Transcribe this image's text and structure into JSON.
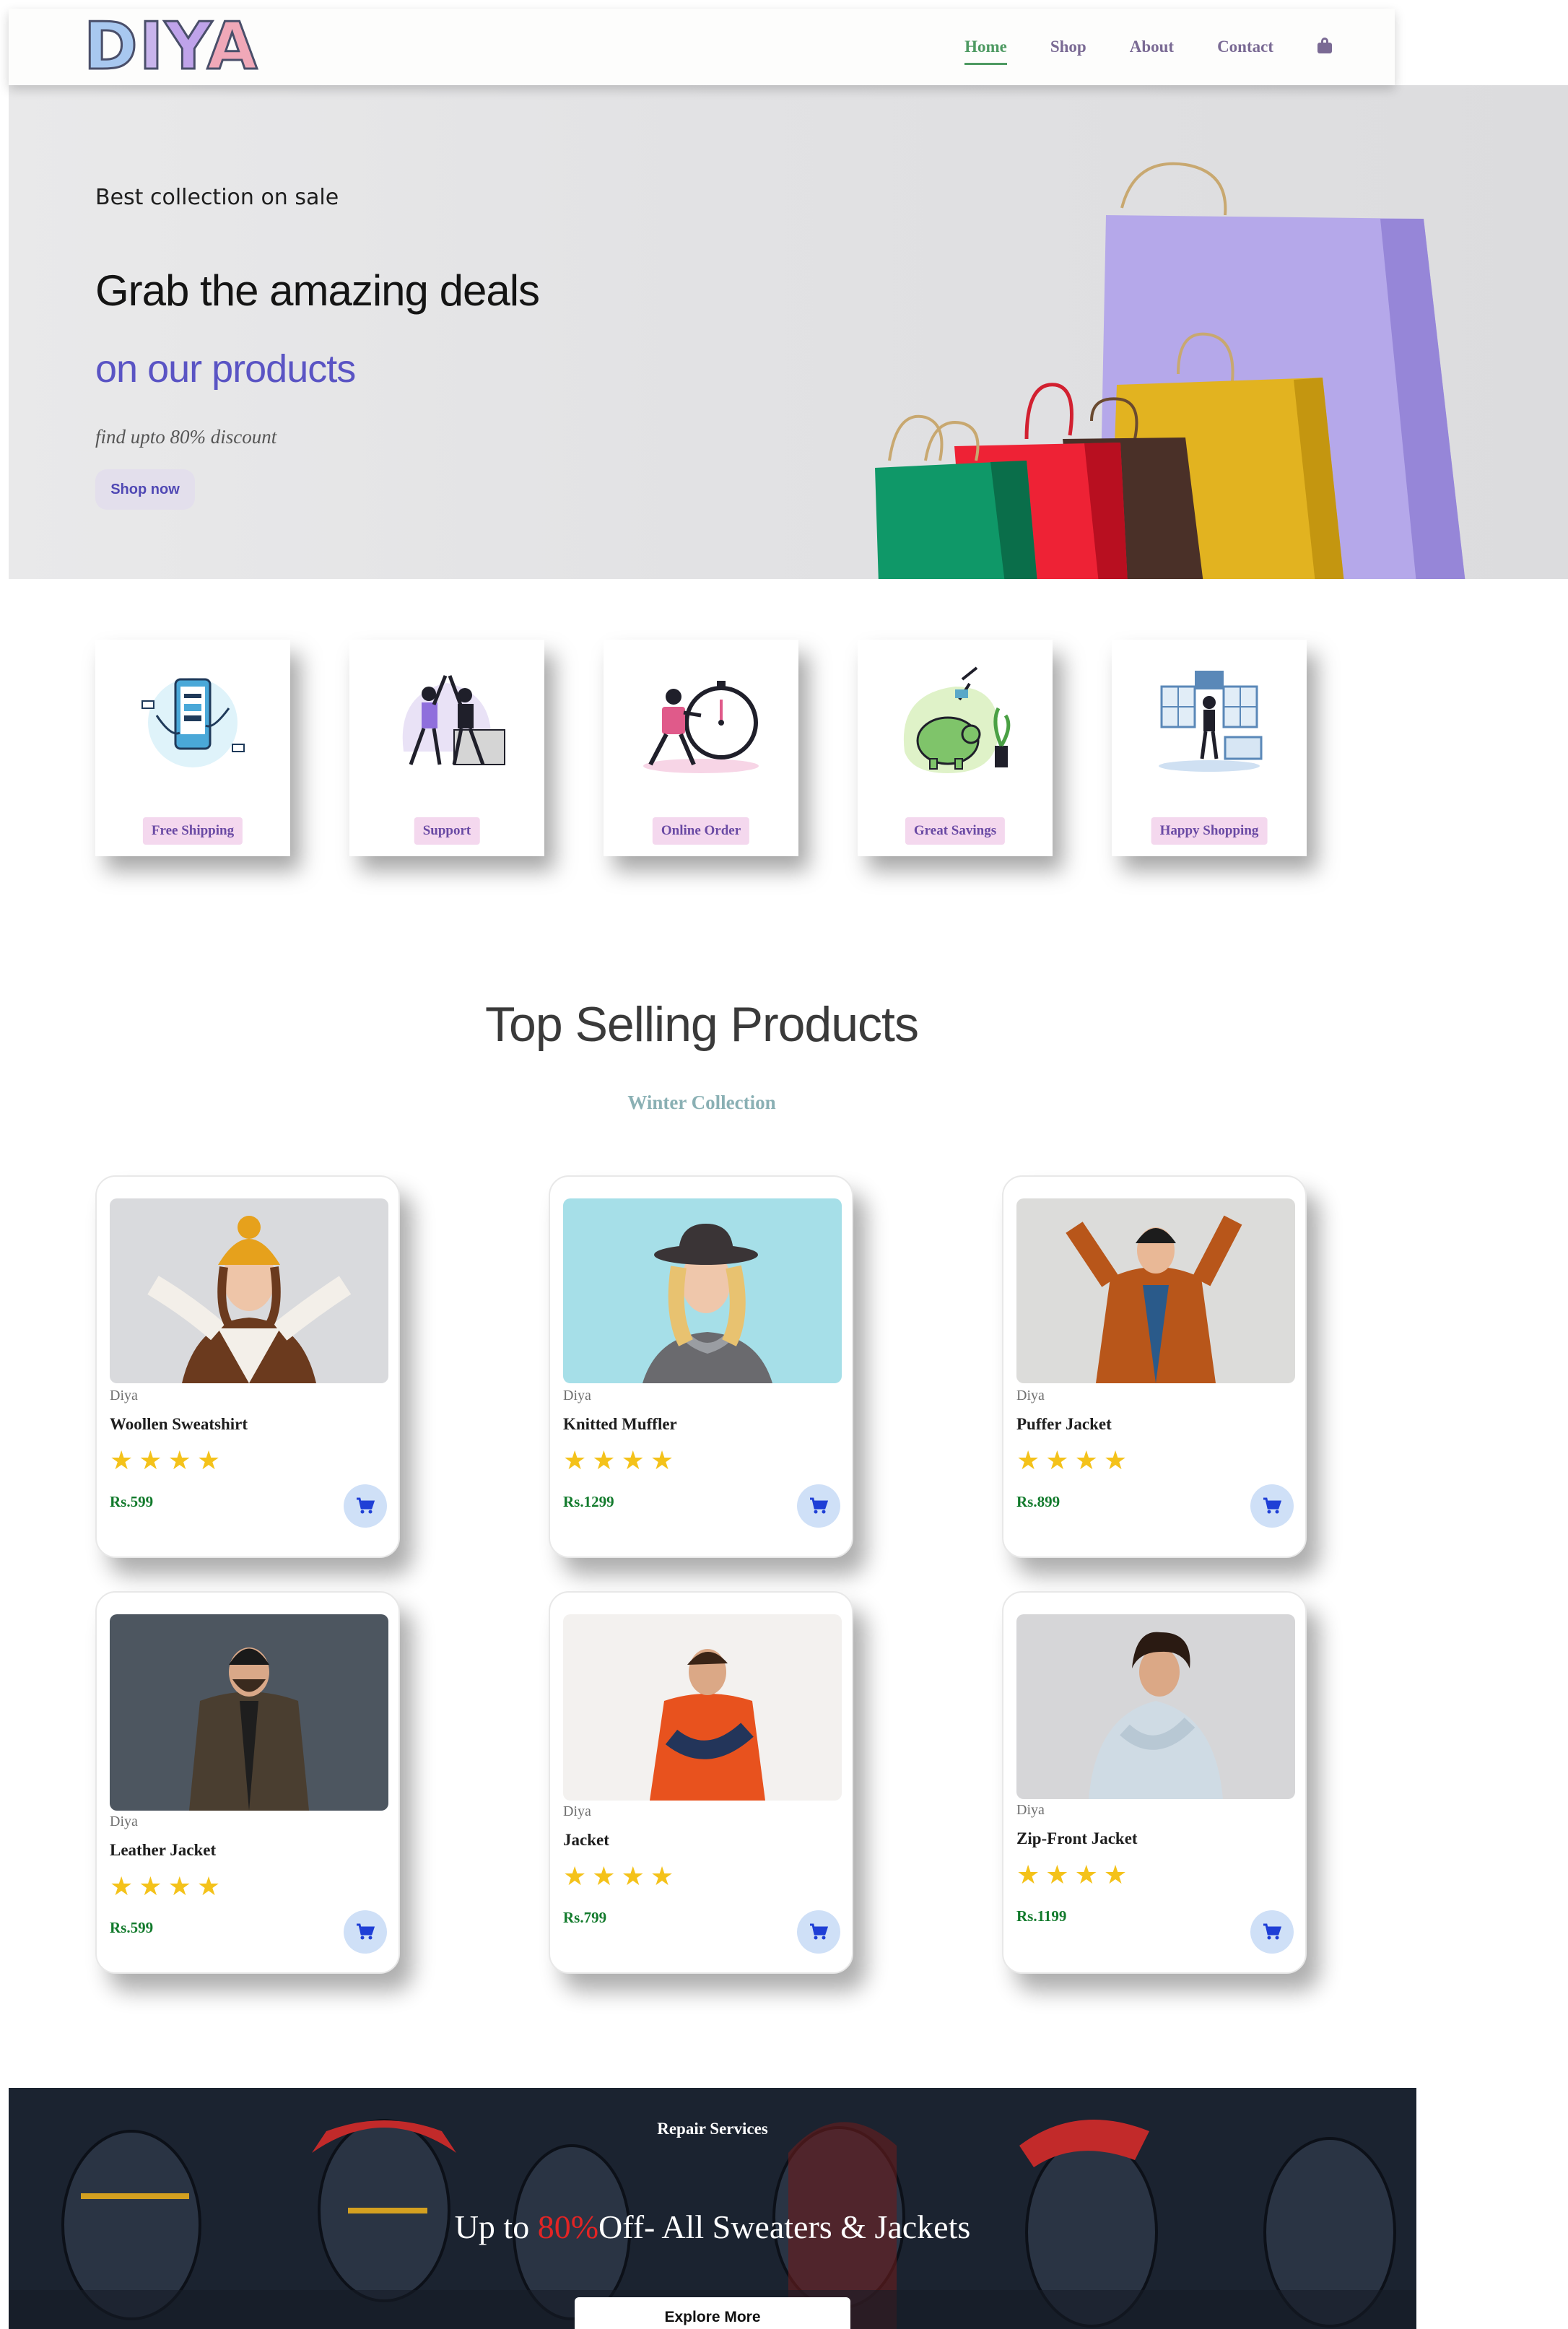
{
  "brand": {
    "logo_letters": [
      "D",
      "I",
      "Y",
      "A"
    ]
  },
  "nav": {
    "links": [
      "Home",
      "Shop",
      "About",
      "Contact"
    ],
    "active": "Home",
    "cart_icon": "shopping-bag-icon"
  },
  "hero": {
    "subtitle": "Best collection on sale",
    "title": "Grab the amazing deals",
    "title_accent": "on our products",
    "discount": "find upto 80% discount",
    "cta": "Shop now",
    "image": "shopping-bags-photo"
  },
  "features": [
    {
      "label": "Free Shipping",
      "icon": "online-payment-illustration"
    },
    {
      "label": "Support",
      "icon": "high-five-team-illustration"
    },
    {
      "label": "Online Order",
      "icon": "courier-stopwatch-illustration"
    },
    {
      "label": "Great Savings",
      "icon": "piggy-bank-illustration"
    },
    {
      "label": "Happy Shopping",
      "icon": "happy-shopper-illustration"
    }
  ],
  "products_section": {
    "title": "Top Selling Products",
    "subtitle": "Winter Collection"
  },
  "products": [
    {
      "brand": "Diya",
      "name": "Woollen Sweatshirt",
      "rating": 4,
      "price": "Rs.599",
      "photo": "woman-yellow-beanie"
    },
    {
      "brand": "Diya",
      "name": "Knitted Muffler",
      "rating": 4,
      "price": "Rs.1299",
      "photo": "woman-hat-scarf"
    },
    {
      "brand": "Diya",
      "name": "Puffer Jacket",
      "rating": 4,
      "price": "Rs.899",
      "photo": "woman-orange-parka"
    },
    {
      "brand": "Diya",
      "name": "Leather Jacket",
      "rating": 4,
      "price": "Rs.599",
      "photo": "man-dark-jacket"
    },
    {
      "brand": "Diya",
      "name": "Jacket",
      "rating": 4,
      "price": "Rs.799",
      "photo": "man-orange-vest"
    },
    {
      "brand": "Diya",
      "name": "Zip-Front Jacket",
      "rating": 4,
      "price": "Rs.1199",
      "photo": "man-white-puffer"
    }
  ],
  "promo": {
    "small_title": "Repair Services",
    "headline_prefix": "Up to",
    "headline_accent": "80%",
    "headline_suffix": "Off- All Sweaters & Jackets",
    "cta": "Explore More"
  },
  "colors": {
    "accent_purple": "#5a54c4",
    "nav_active": "#4e9a62",
    "price_green": "#127a2c",
    "star_yellow": "#f4c21a",
    "promo_red": "#e32424"
  }
}
